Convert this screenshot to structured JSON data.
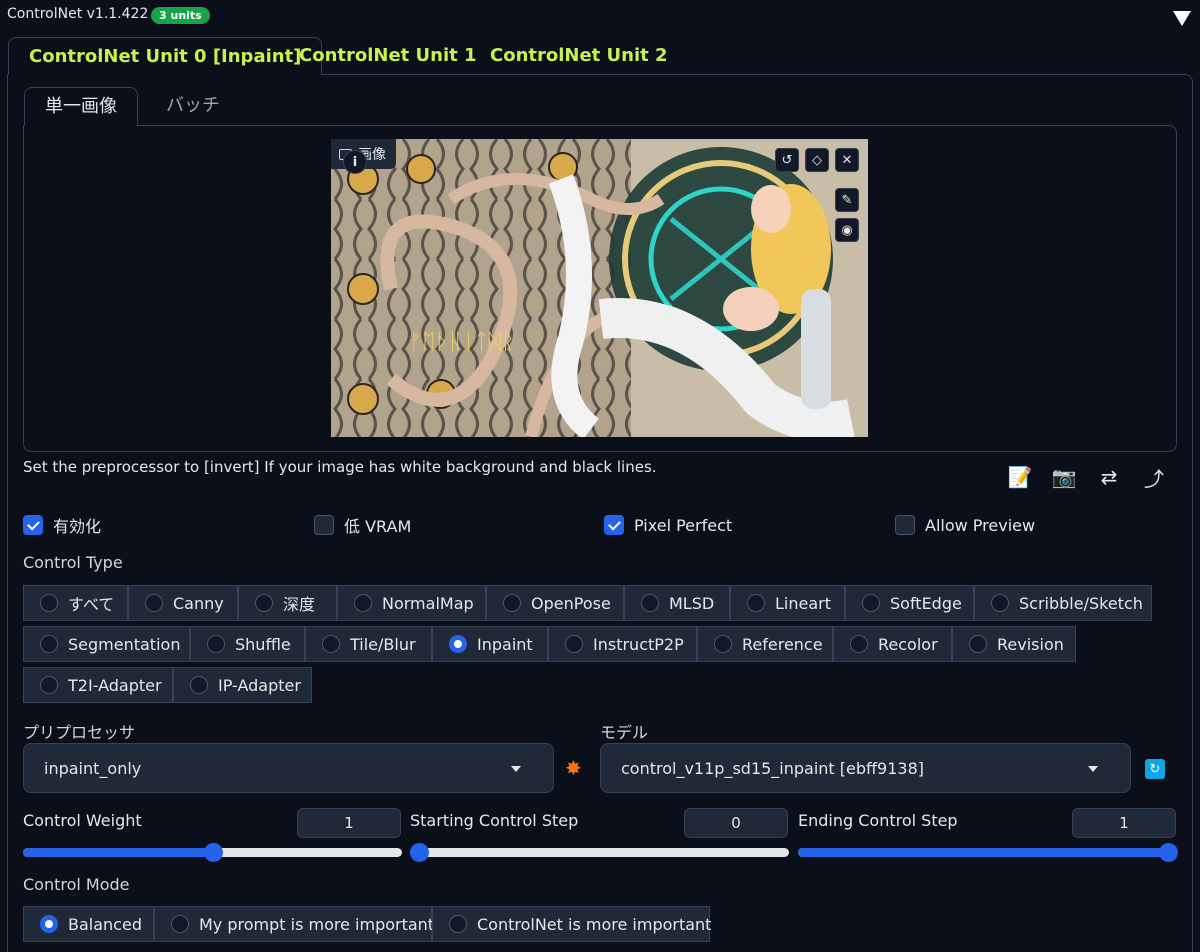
{
  "header": {
    "title": "ControlNet v1.1.422",
    "badge": "3 units"
  },
  "unit_tabs": [
    {
      "label": "ControlNet Unit 0 [Inpaint]",
      "active": true
    },
    {
      "label": "ControlNet Unit 1",
      "active": false
    },
    {
      "label": "ControlNet Unit 2",
      "active": false
    }
  ],
  "image_tabs": [
    {
      "label": "単一画像",
      "active": true
    },
    {
      "label": "バッチ",
      "active": false
    }
  ],
  "image": {
    "label": "画像",
    "artwork_text": "ᚠᛖᚦᚺᛁᛏᛞᚱ"
  },
  "hint": "Set the preprocessor to [invert] If your image has white background and black lines.",
  "checkboxes": [
    {
      "label": "有効化",
      "checked": true
    },
    {
      "label": "低 VRAM",
      "checked": false
    },
    {
      "label": "Pixel Perfect",
      "checked": true
    },
    {
      "label": "Allow Preview",
      "checked": false
    }
  ],
  "control_type": {
    "label": "Control Type",
    "options": [
      "すべて",
      "Canny",
      "深度",
      "NormalMap",
      "OpenPose",
      "MLSD",
      "Lineart",
      "SoftEdge",
      "Scribble/Sketch",
      "Segmentation",
      "Shuffle",
      "Tile/Blur",
      "Inpaint",
      "InstructP2P",
      "Reference",
      "Recolor",
      "Revision",
      "T2I-Adapter",
      "IP-Adapter"
    ],
    "selected": "Inpaint"
  },
  "preprocessor": {
    "label": "プリプロセッサ",
    "value": "inpaint_only"
  },
  "model": {
    "label": "モデル",
    "value": "control_v11p_sd15_inpaint [ebff9138]"
  },
  "sliders": [
    {
      "label": "Control Weight",
      "value": "1",
      "fraction": 0.5
    },
    {
      "label": "Starting Control Step",
      "value": "0",
      "fraction": 0.0
    },
    {
      "label": "Ending Control Step",
      "value": "1",
      "fraction": 1.0
    }
  ],
  "control_mode": {
    "label": "Control Mode",
    "options": [
      "Balanced",
      "My prompt is more important",
      "ControlNet is more important"
    ],
    "selected": "Balanced"
  },
  "colors": {
    "background": "#0b0f19",
    "accent": "#2563eb",
    "tab_text": "#c4f34f",
    "badge": "#16a34a"
  }
}
